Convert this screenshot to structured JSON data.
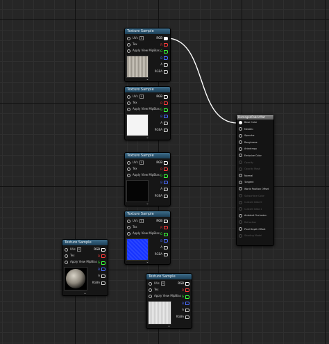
{
  "colors": {
    "pin_r": "#ff3b3b",
    "pin_g": "#3bff3b",
    "pin_b": "#4a6bff",
    "pin_a": "#cfcfcf",
    "header": "#2b5573",
    "wire": "#ffffff"
  },
  "texture_nodes": [
    {
      "title": "Texture Sample",
      "uvs_label": "UVs",
      "uv_index": "0",
      "tex_label": "Tex",
      "mip_label": "Apply View MipBias",
      "outputs": [
        "RGB",
        "R",
        "G",
        "B",
        "A",
        "RGBA"
      ],
      "thumb": "fabric-gray"
    },
    {
      "title": "Texture Sample",
      "uvs_label": "UVs",
      "uv_index": "0",
      "tex_label": "Tex",
      "mip_label": "Apply View MipBias",
      "outputs": [
        "RGB",
        "R",
        "G",
        "B",
        "A",
        "RGBA"
      ],
      "thumb": "white"
    },
    {
      "title": "Texture Sample",
      "uvs_label": "UVs",
      "uv_index": "0",
      "tex_label": "Tex",
      "mip_label": "Apply View MipBias",
      "outputs": [
        "RGB",
        "R",
        "G",
        "B",
        "A",
        "RGBA"
      ],
      "thumb": "black"
    },
    {
      "title": "Texture Sample",
      "uvs_label": "UVs",
      "uv_index": "0",
      "tex_label": "Tex",
      "mip_label": "Apply View MipBias",
      "outputs": [
        "RGB",
        "R",
        "G",
        "B",
        "A",
        "RGBA"
      ],
      "thumb": "normal-blue"
    },
    {
      "title": "Texture Sample",
      "uvs_label": "UVs",
      "uv_index": "0",
      "tex_label": "Tex",
      "mip_label": "Apply View MipBias",
      "outputs": [
        "RGB",
        "R",
        "G",
        "B",
        "A",
        "RGBA"
      ],
      "thumb": "sphere"
    },
    {
      "title": "Texture Sample",
      "uvs_label": "UVs",
      "uv_index": "0",
      "tex_label": "Tex",
      "mip_label": "Apply View MipBias",
      "outputs": [
        "RGB",
        "R",
        "G",
        "B",
        "A",
        "RGBA"
      ],
      "thumb": "fabric-light"
    }
  ],
  "material": {
    "title": "DamagedFabricMat",
    "inputs": [
      {
        "label": "Base Color",
        "enabled": true,
        "connected": true
      },
      {
        "label": "Metallic",
        "enabled": true
      },
      {
        "label": "Specular",
        "enabled": true
      },
      {
        "label": "Roughness",
        "enabled": true
      },
      {
        "label": "Anisotropy",
        "enabled": true
      },
      {
        "label": "Emissive Color",
        "enabled": true
      },
      {
        "label": "Opacity",
        "enabled": false
      },
      {
        "label": "Opacity Mask",
        "enabled": false
      },
      {
        "label": "Normal",
        "enabled": true
      },
      {
        "label": "Tangent",
        "enabled": true
      },
      {
        "label": "World Position Offset",
        "enabled": true
      },
      {
        "label": "Subsurface Color",
        "enabled": false
      },
      {
        "label": "Custom Data 0",
        "enabled": false
      },
      {
        "label": "Custom Data 1",
        "enabled": false
      },
      {
        "label": "Ambient Occlusion",
        "enabled": true
      },
      {
        "label": "Refraction",
        "enabled": false
      },
      {
        "label": "Pixel Depth Offset",
        "enabled": true
      },
      {
        "label": "Shading Model",
        "enabled": false
      }
    ]
  }
}
